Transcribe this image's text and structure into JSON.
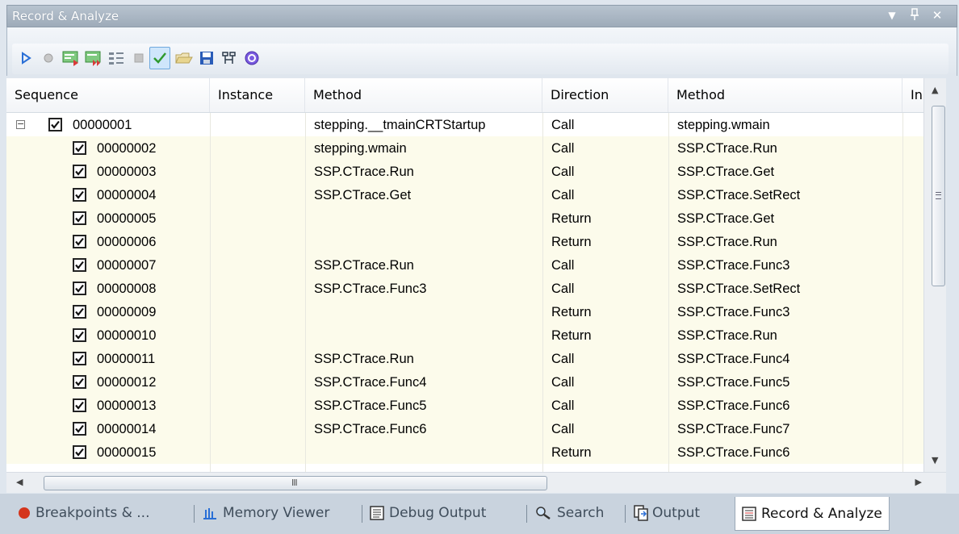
{
  "panel": {
    "title": "Record & Analyze",
    "controls": {
      "menu": "▼",
      "pin": "ᵖ",
      "close": "✕"
    }
  },
  "toolbar": {
    "buttons": [
      {
        "name": "play-icon",
        "color": "#2a6fd6"
      },
      {
        "name": "record-icon",
        "color": "#b8b8b8"
      },
      {
        "name": "step-into-icon",
        "color": "#3aa13a"
      },
      {
        "name": "step-over-icon",
        "color": "#3aa13a"
      },
      {
        "name": "step-out-icon",
        "color": "#7b8794"
      },
      {
        "name": "stop-icon",
        "color": "#b0b0b0"
      },
      {
        "name": "check-icon",
        "color": "#2f9a2f"
      },
      {
        "name": "open-folder-icon",
        "color": "#d9c27a"
      },
      {
        "name": "save-icon",
        "color": "#2a5cb8"
      },
      {
        "name": "structure-icon",
        "color": "#2c3b4a"
      },
      {
        "name": "help-icon",
        "color": "#6a4bcf"
      }
    ]
  },
  "grid": {
    "headers": [
      "Sequence",
      "Instance",
      "Method",
      "Direction",
      "Method",
      "In"
    ],
    "rows": [
      {
        "seq": "00000001",
        "instance": "",
        "method": "stepping.__tmainCRTStartup",
        "direction": "Call",
        "target": "stepping.wmain"
      },
      {
        "seq": "00000002",
        "instance": "",
        "method": "stepping.wmain",
        "direction": "Call",
        "target": "SSP.CTrace.Run"
      },
      {
        "seq": "00000003",
        "instance": "",
        "method": "SSP.CTrace.Run",
        "direction": "Call",
        "target": "SSP.CTrace.Get"
      },
      {
        "seq": "00000004",
        "instance": "",
        "method": "SSP.CTrace.Get",
        "direction": "Call",
        "target": "SSP.CTrace.SetRect"
      },
      {
        "seq": "00000005",
        "instance": "",
        "method": "",
        "direction": "Return",
        "target": "SSP.CTrace.Get"
      },
      {
        "seq": "00000006",
        "instance": "",
        "method": "",
        "direction": "Return",
        "target": "SSP.CTrace.Run"
      },
      {
        "seq": "00000007",
        "instance": "",
        "method": "SSP.CTrace.Run",
        "direction": "Call",
        "target": "SSP.CTrace.Func3"
      },
      {
        "seq": "00000008",
        "instance": "",
        "method": "SSP.CTrace.Func3",
        "direction": "Call",
        "target": "SSP.CTrace.SetRect"
      },
      {
        "seq": "00000009",
        "instance": "",
        "method": "",
        "direction": "Return",
        "target": "SSP.CTrace.Func3"
      },
      {
        "seq": "00000010",
        "instance": "",
        "method": "",
        "direction": "Return",
        "target": "SSP.CTrace.Run"
      },
      {
        "seq": "00000011",
        "instance": "",
        "method": "SSP.CTrace.Run",
        "direction": "Call",
        "target": "SSP.CTrace.Func4"
      },
      {
        "seq": "00000012",
        "instance": "",
        "method": "SSP.CTrace.Func4",
        "direction": "Call",
        "target": "SSP.CTrace.Func5"
      },
      {
        "seq": "00000013",
        "instance": "",
        "method": "SSP.CTrace.Func5",
        "direction": "Call",
        "target": "SSP.CTrace.Func6"
      },
      {
        "seq": "00000014",
        "instance": "",
        "method": "SSP.CTrace.Func6",
        "direction": "Call",
        "target": "SSP.CTrace.Func7"
      },
      {
        "seq": "00000015",
        "instance": "",
        "method": "",
        "direction": "Return",
        "target": "SSP.CTrace.Func6"
      }
    ],
    "expander": "−",
    "hscroll_grip": "III"
  },
  "tabs": [
    {
      "label": "Breakpoints & ...",
      "icon": "breakpoint-icon",
      "active": false
    },
    {
      "label": "Memory Viewer",
      "icon": "memory-viewer-icon",
      "active": false
    },
    {
      "label": "Debug Output",
      "icon": "debug-output-icon",
      "active": false
    },
    {
      "label": "Search",
      "icon": "search-icon",
      "active": false
    },
    {
      "label": "Output",
      "icon": "output-icon",
      "active": false
    },
    {
      "label": "Record & Analyze",
      "icon": "record-analyze-icon",
      "active": true
    }
  ]
}
